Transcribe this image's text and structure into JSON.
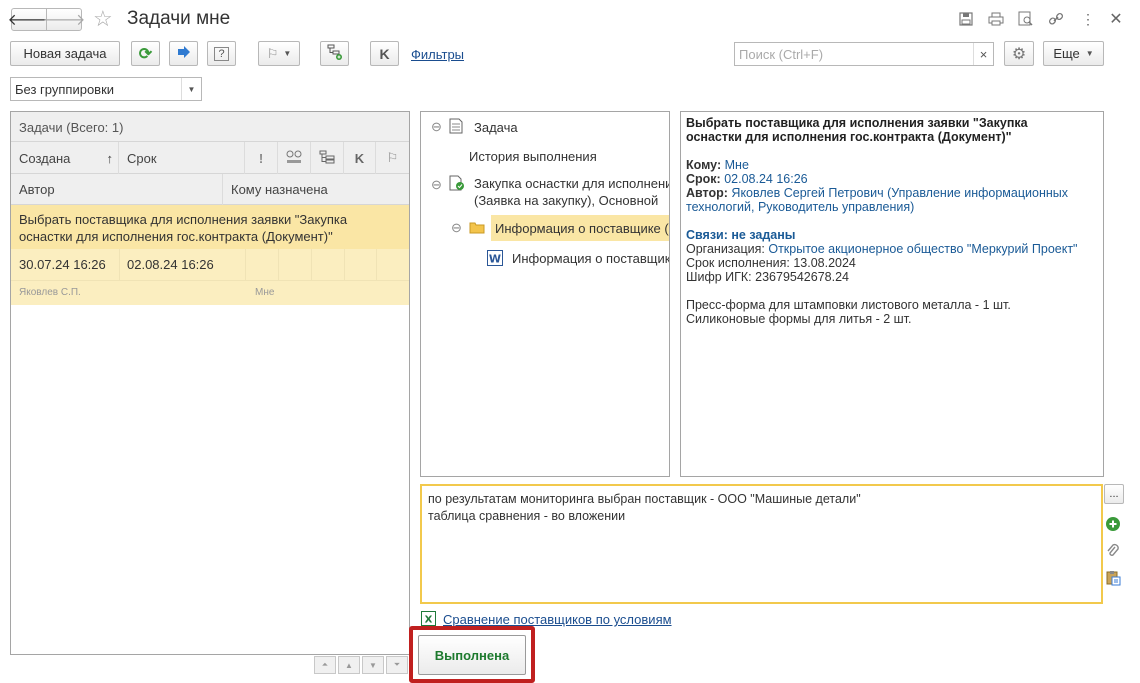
{
  "window": {
    "title": "Задачи мне"
  },
  "toolbar": {
    "new_task": "Новая задача",
    "filters": "Фильтры",
    "search_placeholder": "Поиск (Ctrl+F)",
    "search_clear": "×",
    "more": "Еще",
    "k_label": "K"
  },
  "grouping": {
    "value": "Без группировки"
  },
  "task_list": {
    "header": "Задачи (Всего: 1)",
    "columns": {
      "created": "Создана",
      "sort_arrow": "↑",
      "due": "Срок",
      "author": "Автор",
      "assigned": "Кому назначена",
      "k": "K",
      "excl": "!"
    },
    "rows": [
      {
        "title": "Выбрать поставщика для исполнения заявки \"Закупка оснастки для исполнения гос.контракта (Документ)\"",
        "created": "30.07.24 16:26",
        "due": "02.08.24 16:26",
        "author": "Яковлев С.П.",
        "assignee": "Мне"
      }
    ]
  },
  "tree": {
    "items": [
      {
        "label": "Задача",
        "toggle": "⊖"
      },
      {
        "label": "История выполнения",
        "toggle": ""
      },
      {
        "label_line1": "Закупка оснастки для исполнени",
        "label_line2": "(Заявка на закупку), Основной",
        "toggle": "⊖"
      },
      {
        "label": "Информация о поставщике (1",
        "toggle": "⊖"
      },
      {
        "label": "Информация о поставщик",
        "toggle": ""
      }
    ]
  },
  "details": {
    "title": "Выбрать поставщика для исполнения заявки \"Закупка оснастки для исполнения гос.контракта (Документ)\"",
    "to_label": "Кому:",
    "to_value": "Мне",
    "due_label": "Срок:",
    "due_value": "02.08.24 16:26",
    "author_label": "Автор:",
    "author_value": "Яковлев Сергей Петрович (Управление информационных технологий, Руководитель управления)",
    "links_label": "Связи: не заданы",
    "org_label": "Организация:",
    "org_value": "Открытое акционерное общество \"Меркурий Проект\"",
    "exec_label": "Срок исполнения:",
    "exec_value": "13.08.2024",
    "igk_label": "Шифр ИГК:",
    "igk_value": "23679542678.24",
    "items_line1": "Пресс-форма для штамповки листового металла - 1 шт.",
    "items_line2": "Силиконовые формы для литья - 2 шт."
  },
  "comment": {
    "line1": "по результатам мониторинга выбран поставщик - ООО \"Машиные детали\"",
    "line2": "таблица сравнения - во вложении",
    "more_button": "..."
  },
  "attachment": {
    "name": "Сравнение поставщиков по условиям"
  },
  "actions": {
    "done": "Выполнена"
  }
}
